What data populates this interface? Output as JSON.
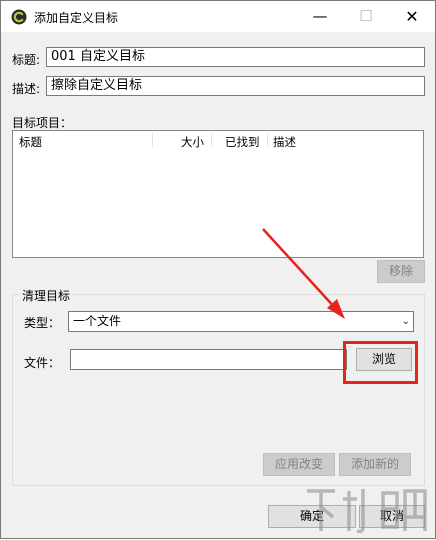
{
  "window": {
    "title": "添加自定义目标",
    "minimize_glyph": "—",
    "maximize_glyph": "☐",
    "close_glyph": "✕"
  },
  "form": {
    "title_label": "标题:",
    "title_value": "001 自定义目标",
    "desc_label": "描述:",
    "desc_value": "擦除自定义目标"
  },
  "items": {
    "section_label": "目标项目：",
    "columns": [
      "标题",
      "大小",
      "已找到",
      "描述"
    ],
    "rows": [],
    "remove_button": "移除"
  },
  "clean_target": {
    "group_label": "清理目标",
    "type_label": "类型：",
    "type_value": "一个文件",
    "file_label": "文件：",
    "file_value": "",
    "browse_button": "浏览",
    "apply_button": "应用改变",
    "add_button": "添加新的"
  },
  "footer": {
    "ok_button": "确定",
    "cancel_button": "取消"
  },
  "annotation": {
    "highlight_color": "#e8231e",
    "watermark_text": "下载吧"
  }
}
